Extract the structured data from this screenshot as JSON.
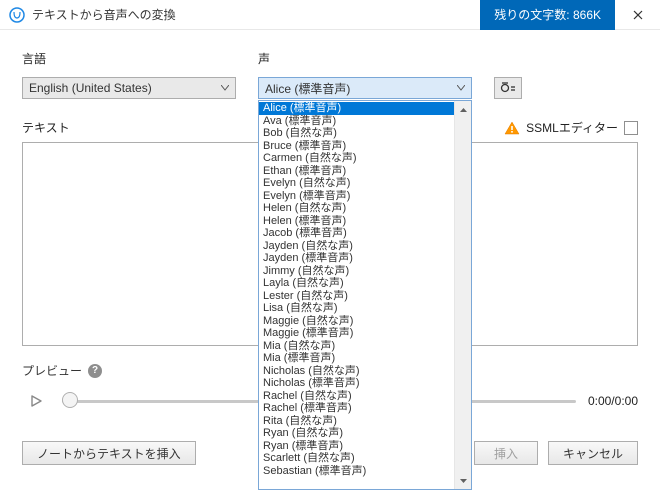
{
  "titlebar": {
    "title": "テキストから音声への変換",
    "remaining": "残りの文字数: 866K"
  },
  "labels": {
    "language": "言語",
    "voice": "声",
    "text": "テキスト",
    "ssml": "SSMLエディター",
    "preview": "プレビュー",
    "time": "0:00/0:00"
  },
  "selects": {
    "language_value": "English (United States)",
    "voice_value": "Alice (標準音声)"
  },
  "buttons": {
    "insert_from_note": "ノートからテキストを挿入",
    "insert": "挿入",
    "cancel": "キャンセル"
  },
  "voice_options": [
    "Alice (標準音声)",
    "Ava (標準音声)",
    "Bob (自然な声)",
    "Bruce (標準音声)",
    "Carmen (自然な声)",
    "Ethan (標準音声)",
    "Evelyn (自然な声)",
    "Evelyn (標準音声)",
    "Helen (自然な声)",
    "Helen (標準音声)",
    "Jacob (標準音声)",
    "Jayden (自然な声)",
    "Jayden (標準音声)",
    "Jimmy (自然な声)",
    "Layla (自然な声)",
    "Lester (自然な声)",
    "Lisa (自然な声)",
    "Maggie (自然な声)",
    "Maggie (標準音声)",
    "Mia (自然な声)",
    "Mia (標準音声)",
    "Nicholas (自然な声)",
    "Nicholas (標準音声)",
    "Rachel (自然な声)",
    "Rachel (標準音声)",
    "Rita (自然な声)",
    "Ryan (自然な声)",
    "Ryan (標準音声)",
    "Scarlett (自然な声)",
    "Sebastian (標準音声)"
  ],
  "voice_selected_index": 0
}
